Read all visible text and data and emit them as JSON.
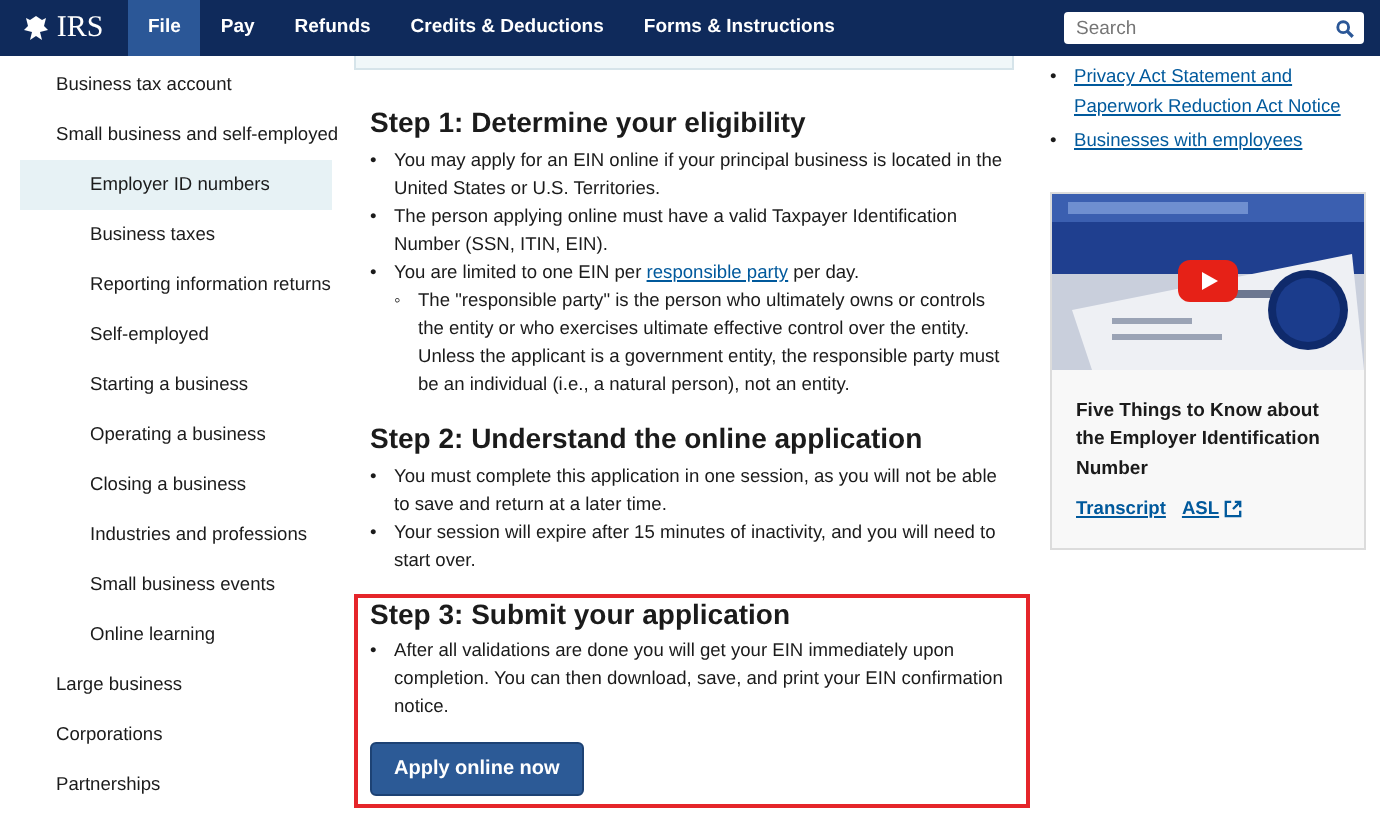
{
  "header": {
    "logo": "IRS",
    "nav": [
      {
        "label": "File",
        "selected": true
      },
      {
        "label": "Pay",
        "selected": false
      },
      {
        "label": "Refunds",
        "selected": false
      },
      {
        "label": "Credits & Deductions",
        "selected": false
      },
      {
        "label": "Forms & Instructions",
        "selected": false
      }
    ],
    "search": {
      "placeholder": "Search"
    }
  },
  "sidebar": {
    "items": [
      {
        "label": "Business tax account",
        "selected": false
      },
      {
        "label": "Small business and self-employed",
        "selected": false,
        "children": [
          {
            "label": "Employer ID numbers",
            "selected": true
          },
          {
            "label": "Business taxes",
            "selected": false
          },
          {
            "label": "Reporting information returns",
            "selected": false
          },
          {
            "label": "Self-employed",
            "selected": false
          },
          {
            "label": "Starting a business",
            "selected": false
          },
          {
            "label": "Operating a business",
            "selected": false
          },
          {
            "label": "Closing a business",
            "selected": false
          },
          {
            "label": "Industries and professions",
            "selected": false
          },
          {
            "label": "Small business events",
            "selected": false
          },
          {
            "label": "Online learning",
            "selected": false
          }
        ]
      },
      {
        "label": "Large business",
        "selected": false
      },
      {
        "label": "Corporations",
        "selected": false
      },
      {
        "label": "Partnerships",
        "selected": false
      }
    ]
  },
  "main": {
    "steps": [
      {
        "heading": "Step 1: Determine your eligibility",
        "bullets": [
          {
            "marker": "•",
            "parts": [
              {
                "kind": "text",
                "text": "You may apply for an EIN online if your principal business is located in the United States or U.S. Territories."
              }
            ]
          },
          {
            "marker": "•",
            "parts": [
              {
                "kind": "text",
                "text": "The person applying online must have a valid Taxpayer Identification Number (SSN, ITIN, EIN)."
              }
            ]
          },
          {
            "marker": "•",
            "parts": [
              {
                "kind": "text",
                "text": "You are limited to one EIN per "
              },
              {
                "kind": "link",
                "text": "responsible party"
              },
              {
                "kind": "text",
                "text": " per day."
              }
            ],
            "children": [
              {
                "marker": "◦",
                "parts": [
                  {
                    "kind": "text",
                    "text": "The \"responsible party\" is the person who ultimately owns or controls the entity or who exercises ultimate effective control over the entity. Unless the applicant is a government entity, the responsible party must be an individual (i.e., a natural person), not an entity."
                  }
                ]
              }
            ]
          }
        ]
      },
      {
        "heading": "Step 2: Understand the online application",
        "bullets": [
          {
            "marker": "•",
            "parts": [
              {
                "kind": "text",
                "text": "You must complete this application in one session, as you will not be able to save and return at a later time."
              }
            ]
          },
          {
            "marker": "•",
            "parts": [
              {
                "kind": "text",
                "text": "Your session will expire after 15 minutes of inactivity, and you will need to start over."
              }
            ]
          }
        ]
      },
      {
        "heading": "Step 3: Submit your application",
        "highlighted": true,
        "bullets": [
          {
            "marker": "•",
            "parts": [
              {
                "kind": "text",
                "text": "After all validations are done you will get your EIN immediately upon completion. You can then download, save, and print your EIN confirmation notice."
              }
            ]
          }
        ],
        "button": "Apply online now"
      }
    ]
  },
  "aside": {
    "links": [
      {
        "marker": "•",
        "text": "Privacy Act Statement and Paperwork Reduction Act Notice"
      },
      {
        "marker": "•",
        "text": "Businesses with employees"
      }
    ],
    "video": {
      "kind": "picture",
      "title": "Five Things to Know about the Employer Identification Number",
      "links": [
        {
          "label": "Transcript"
        },
        {
          "label": "ASL",
          "external": true
        }
      ]
    }
  }
}
